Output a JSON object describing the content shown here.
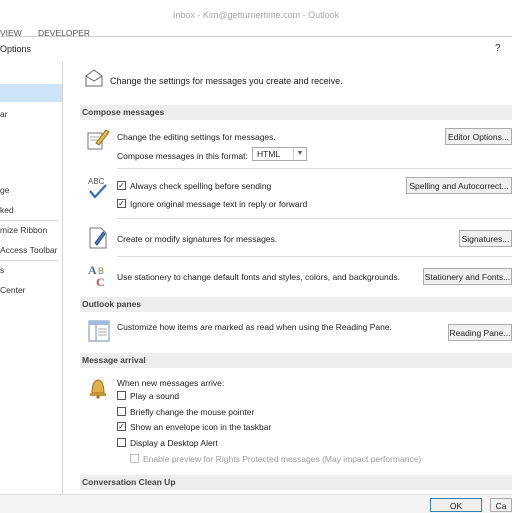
{
  "window": {
    "title": "Inbox - Kim@getturnertime.com - Outlook"
  },
  "ribbon": {
    "tabs": [
      "VIEW",
      "DEVELOPER"
    ]
  },
  "dialog": {
    "title": "Options",
    "help": "?"
  },
  "nav": {
    "items": [
      {
        "label": ""
      },
      {
        "label": ""
      },
      {
        "label": "ar"
      },
      {
        "label": "ge"
      },
      {
        "label": "ked"
      },
      {
        "label": "mize Ribbon"
      },
      {
        "label": "Access Toolbar"
      },
      {
        "label": "s"
      },
      {
        "label": "Center"
      }
    ]
  },
  "intro": {
    "text": "Change the settings for messages you create and receive."
  },
  "compose": {
    "header": "Compose messages",
    "editing_text": "Change the editing settings for messages.",
    "editor_button": "Editor Options...",
    "format_label": "Compose messages in this format:",
    "format_value": "HTML",
    "spell_label": "Always check spelling before sending",
    "spell_button": "Spelling and Autocorrect...",
    "ignore_label": "Ignore original message text in reply or forward",
    "sig_text": "Create or modify signatures for messages.",
    "sig_button": "Signatures...",
    "stationery_text": "Use stationery to change default fonts and styles, colors, and backgrounds.",
    "stationery_button": "Stationery and Fonts..."
  },
  "panes": {
    "header": "Outlook panes",
    "reading_text": "Customize how items are marked as read when using the Reading Pane.",
    "reading_button": "Reading Pane..."
  },
  "arrival": {
    "header": "Message arrival",
    "when_label": "When new messages arrive:",
    "options": [
      {
        "label": "Play a sound",
        "checked": false
      },
      {
        "label": "Briefly change the mouse pointer",
        "checked": false
      },
      {
        "label": "Show an envelope icon in the taskbar",
        "checked": true
      },
      {
        "label": "Display a Desktop Alert",
        "checked": false
      }
    ],
    "preview_label": "Enable preview for Rights Protected messages (May impact performance)"
  },
  "cleanup": {
    "header": "Conversation Clean Up"
  },
  "footer": {
    "ok": "OK",
    "cancel": "Ca"
  },
  "colors": {
    "nav_selected": "#cde4f7",
    "section_bg": "#eeeeee"
  }
}
